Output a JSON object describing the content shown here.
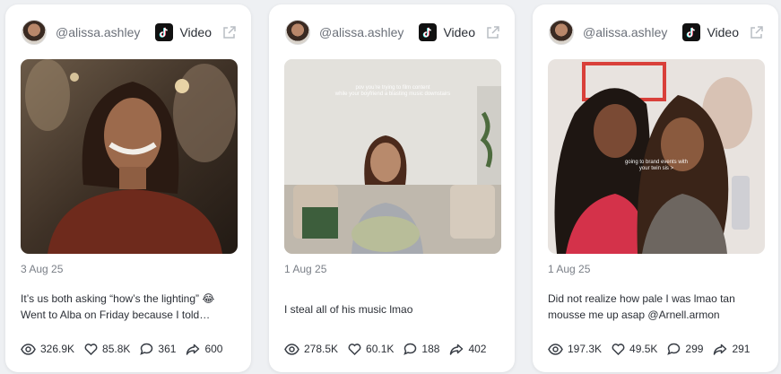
{
  "posts": [
    {
      "handle": "@alissa.ashley",
      "type_label": "Video",
      "platform_icon": "tiktok-icon",
      "date": "3 Aug 25",
      "caption_line1": "It’s us both asking “how’s the lighting” 😂",
      "caption_line2": "Went to Alba on Friday because I told…",
      "thumbnail_overlay": [],
      "stats": {
        "views": "326.9K",
        "likes": "85.8K",
        "comments": "361",
        "shares": "600"
      }
    },
    {
      "handle": "@alissa.ashley",
      "type_label": "Video",
      "platform_icon": "tiktok-icon",
      "date": "1 Aug 25",
      "caption_line1": "I steal all of his music lmao",
      "caption_line2": "",
      "thumbnail_overlay": [
        "pov you’re trying to film content",
        "while your boyfriend a blasting music downstairs"
      ],
      "stats": {
        "views": "278.5K",
        "likes": "60.1K",
        "comments": "188",
        "shares": "402"
      }
    },
    {
      "handle": "@alissa.ashley",
      "type_label": "Video",
      "platform_icon": "tiktok-icon",
      "date": "1 Aug 25",
      "caption_line1": "Did not realize how pale I was lmao tan",
      "caption_line2": "mousse me up asap @Arnell.armon",
      "thumbnail_overlay": [
        "going to brand events with",
        "your twin sis >"
      ],
      "stats": {
        "views": "197.3K",
        "likes": "49.5K",
        "comments": "299",
        "shares": "291"
      }
    }
  ],
  "colors": {
    "card_bg": "#ffffff",
    "page_bg": "#eef0f3",
    "muted_text": "#7a7f87",
    "icon_stroke": "#3a3f47"
  }
}
